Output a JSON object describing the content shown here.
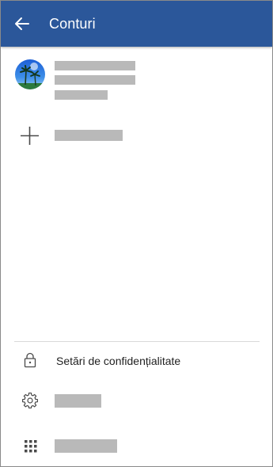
{
  "header": {
    "title": "Conturi",
    "background_color": "#2b579a",
    "back_icon": "arrow-left-icon"
  },
  "accounts": [
    {
      "avatar_icon": "palm-trees-avatar"
    }
  ],
  "add_account": {
    "icon": "plus-icon"
  },
  "menu": {
    "privacy": {
      "label": "Setări de confidențialitate",
      "icon": "lock-icon"
    },
    "settings": {
      "icon": "gear-icon"
    },
    "apps": {
      "icon": "grid-icon"
    }
  }
}
